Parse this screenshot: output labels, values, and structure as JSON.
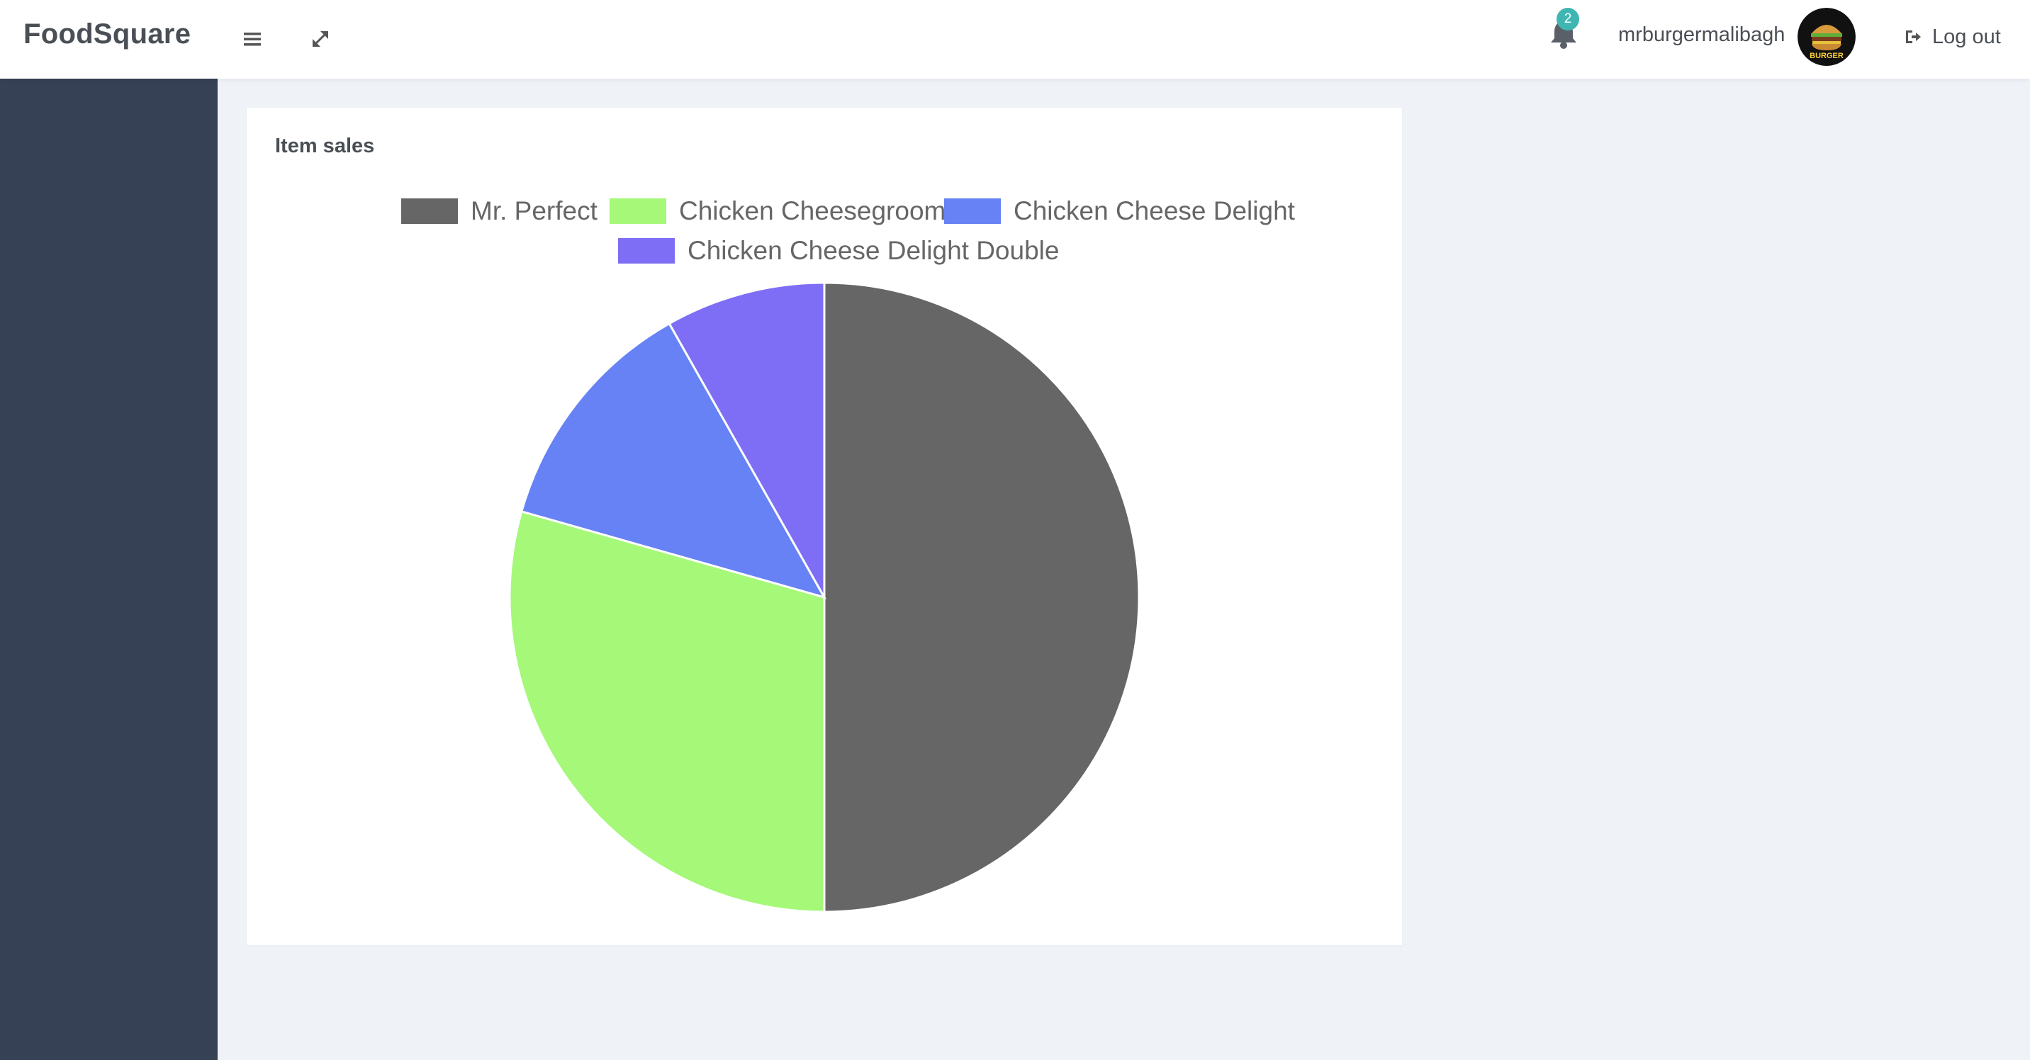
{
  "app": {
    "brand": "FoodSquare"
  },
  "header": {
    "menu_icon": "hamburger-menu-icon",
    "expand_icon": "fullscreen-expand-icon",
    "notifications": {
      "icon": "bell-icon",
      "count": "2"
    },
    "username": "mrburgermalibagh",
    "avatar": {
      "icon": "burger-logo",
      "logo_text": "BURGER"
    },
    "logout": {
      "icon": "sign-out-icon",
      "label": "Log out"
    }
  },
  "card": {
    "title": "Item sales"
  },
  "chart_data": {
    "type": "pie",
    "title": "",
    "labels": [
      "Mr. Perfect",
      "Chicken Cheesegroom",
      "Chicken Cheese Delight",
      "Chicken Cheese Delight Double"
    ],
    "values": [
      50.0,
      29.4,
      12.4,
      8.2
    ],
    "colors": [
      "#666666",
      "#a5f878",
      "#6682f4",
      "#7e6ef5"
    ],
    "legend_position": "top"
  }
}
